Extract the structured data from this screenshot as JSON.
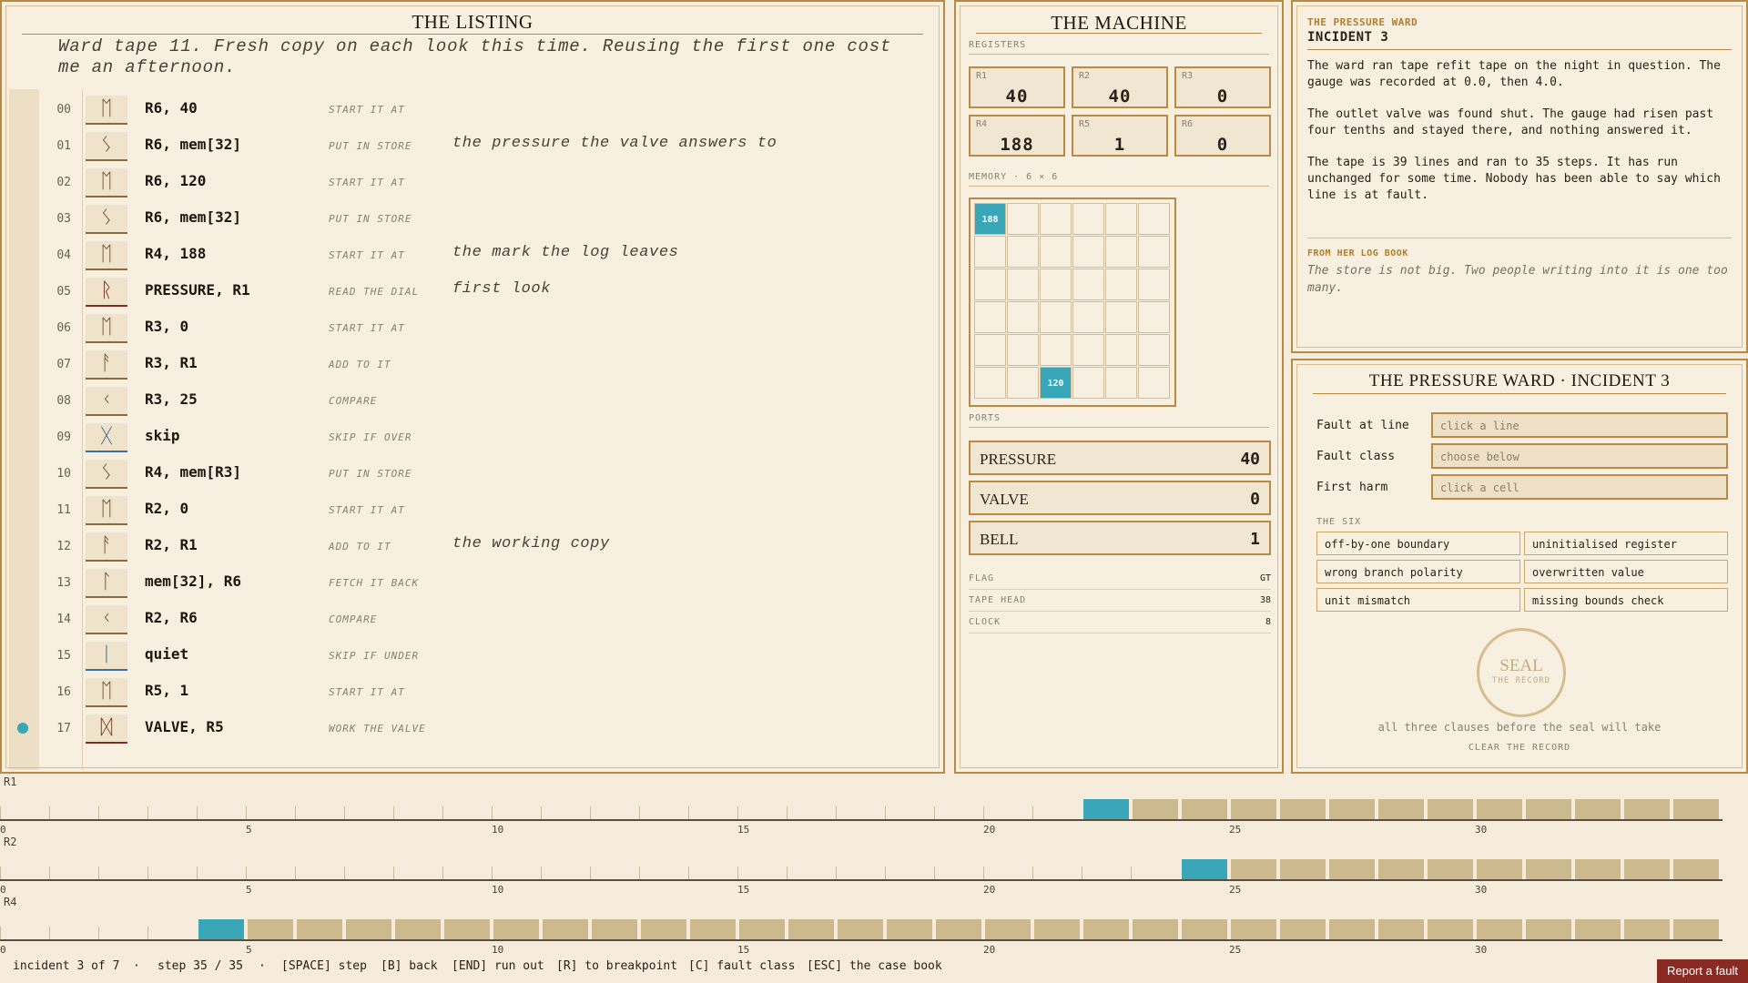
{
  "listing": {
    "title": "THE LISTING",
    "note": "Ward tape 11. Fresh copy on each look this time. Reusing the first one cost me an afternoon.",
    "rows": [
      {
        "n": "00",
        "rune": "ᛖ",
        "op": "R6, 40",
        "gloss": "START IT AT",
        "comment": ""
      },
      {
        "n": "01",
        "rune": "ᛊ",
        "op": "R6, mem[32]",
        "gloss": "PUT IN STORE",
        "comment": "the pressure the valve answers to"
      },
      {
        "n": "02",
        "rune": "ᛖ",
        "op": "R6, 120",
        "gloss": "START IT AT",
        "comment": ""
      },
      {
        "n": "03",
        "rune": "ᛊ",
        "op": "R6, mem[32]",
        "gloss": "PUT IN STORE",
        "comment": ""
      },
      {
        "n": "04",
        "rune": "ᛖ",
        "op": "R4, 188",
        "gloss": "START IT AT",
        "comment": "the mark the log leaves"
      },
      {
        "n": "05",
        "rune": "ᚱ",
        "op": "PRESSURE, R1",
        "gloss": "READ THE DIAL",
        "comment": "first look"
      },
      {
        "n": "06",
        "rune": "ᛖ",
        "op": "R3, 0",
        "gloss": "START IT AT",
        "comment": ""
      },
      {
        "n": "07",
        "rune": "ᚨ",
        "op": "R3, R1",
        "gloss": "ADD TO IT",
        "comment": ""
      },
      {
        "n": "08",
        "rune": "ᚲ",
        "op": "R3, 25",
        "gloss": "COMPARE",
        "comment": ""
      },
      {
        "n": "09",
        "rune": "ᚷ",
        "op": "skip",
        "gloss": "SKIP IF OVER",
        "comment": ""
      },
      {
        "n": "10",
        "rune": "ᛊ",
        "op": "R4, mem[R3]",
        "gloss": "PUT IN STORE",
        "comment": ""
      },
      {
        "n": "11",
        "rune": "ᛖ",
        "op": "R2, 0",
        "gloss": "START IT AT",
        "comment": ""
      },
      {
        "n": "12",
        "rune": "ᚨ",
        "op": "R2, R1",
        "gloss": "ADD TO IT",
        "comment": "the working copy"
      },
      {
        "n": "13",
        "rune": "ᛚ",
        "op": "mem[32], R6",
        "gloss": "FETCH IT BACK",
        "comment": ""
      },
      {
        "n": "14",
        "rune": "ᚲ",
        "op": "R2, R6",
        "gloss": "COMPARE",
        "comment": ""
      },
      {
        "n": "15",
        "rune": "ᛁ",
        "op": "quiet",
        "gloss": "SKIP IF UNDER",
        "comment": ""
      },
      {
        "n": "16",
        "rune": "ᛖ",
        "op": "R5, 1",
        "gloss": "START IT AT",
        "comment": ""
      },
      {
        "n": "17",
        "rune": "ᛞ",
        "op": "VALVE, R5",
        "gloss": "WORK THE VALVE",
        "comment": ""
      }
    ],
    "breakpoint_row": "17"
  },
  "machine": {
    "title": "THE MACHINE",
    "registers_label": "REGISTERS",
    "registers": [
      {
        "name": "R1",
        "value": "40"
      },
      {
        "name": "R2",
        "value": "40"
      },
      {
        "name": "R3",
        "value": "0"
      },
      {
        "name": "R4",
        "value": "188"
      },
      {
        "name": "R5",
        "value": "1"
      },
      {
        "name": "R6",
        "value": "0"
      }
    ],
    "memory_label": "MEMORY · 6 × 6",
    "memory_cells": [
      {
        "index": 0,
        "value": "188"
      },
      {
        "index": 32,
        "value": "120"
      }
    ],
    "ports_label": "PORTS",
    "ports": [
      {
        "name": "PRESSURE",
        "value": "40"
      },
      {
        "name": "VALVE",
        "value": "0"
      },
      {
        "name": "BELL",
        "value": "1"
      }
    ],
    "stats": [
      {
        "name": "FLAG",
        "value": "GT"
      },
      {
        "name": "TAPE HEAD",
        "value": "38"
      },
      {
        "name": "CLOCK",
        "value": "8"
      }
    ]
  },
  "ward": {
    "header": "THE PRESSURE WARD",
    "incident": "INCIDENT 3",
    "p1": "The ward ran tape refit tape on the night in question. The gauge was recorded at 0.0, then 4.0.",
    "p2": "The outlet valve was found shut. The gauge had risen past four tenths and stayed there, and nothing answered it.",
    "p3": "The tape is 39 lines and ran to 35 steps. It has run unchanged for some time. Nobody has been able to say which line is at fault.",
    "log_label": "FROM HER LOG BOOK",
    "log_text": "The store is not big. Two people writing into it is one too many."
  },
  "record": {
    "title": "THE PRESSURE WARD · INCIDENT 3",
    "fields": [
      {
        "label": "Fault at line",
        "placeholder": "click a line"
      },
      {
        "label": "Fault class",
        "placeholder": "choose below"
      },
      {
        "label": "First harm",
        "placeholder": "click a cell"
      }
    ],
    "six_label": "THE SIX",
    "classes": [
      "off-by-one boundary",
      "uninitialised register",
      "wrong branch polarity",
      "overwritten value",
      "unit mismatch",
      "missing bounds check"
    ],
    "seal_main": "SEAL",
    "seal_sub": "THE RECORD",
    "hint": "all three clauses before the seal will take",
    "clear": "CLEAR THE RECORD"
  },
  "timelines": [
    {
      "name": "R1",
      "changed_at": 22
    },
    {
      "name": "R2",
      "changed_at": 24
    },
    {
      "name": "R4",
      "changed_at": 4
    }
  ],
  "timeline_ticks": [
    "0",
    "5",
    "10",
    "15",
    "20",
    "25",
    "30"
  ],
  "timeline_steps": 35,
  "status": {
    "incident": "incident 3 of 7",
    "step": "step 35 / 35",
    "keys": [
      "[SPACE] step",
      "[B] back",
      "[END] run out",
      "[R] to breakpoint",
      "[C] fault class",
      "[ESC] the case book"
    ],
    "report": "Report a fault"
  },
  "colors": {
    "accent": "#b88a45",
    "highlight": "#3aa7b8",
    "filled": "#ccb98d",
    "report": "#8a2a22"
  }
}
